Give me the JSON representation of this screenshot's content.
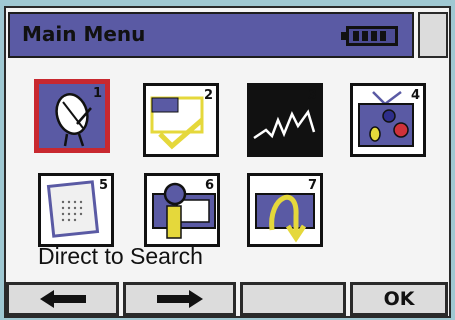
{
  "title": "Main Menu",
  "status": {
    "battery_icon": "battery-icon"
  },
  "menu": {
    "items": [
      {
        "number": "1",
        "icon": "satellite-dish-icon"
      },
      {
        "number": "2",
        "icon": "yellow-checkmark-screen-icon"
      },
      {
        "number": "3",
        "icon": "signal-waveform-icon"
      },
      {
        "number": "4",
        "icon": "television-icon"
      },
      {
        "number": "5",
        "icon": "keypad-dots-icon"
      },
      {
        "number": "6",
        "icon": "magnifier-screen-icon"
      },
      {
        "number": "7",
        "icon": "arrow-loop-icon"
      }
    ],
    "selected_index": 0
  },
  "status_text": "Direct to Search",
  "softkeys": {
    "left_arrow": "left-arrow-icon",
    "right_arrow": "right-arrow-icon",
    "blank": "",
    "ok_label": "OK"
  },
  "colors": {
    "titlebar": "#5a5aa4",
    "selection": "#c8282f",
    "accent_yellow": "#e5d83b",
    "accent_purple": "#5a5aa4"
  }
}
